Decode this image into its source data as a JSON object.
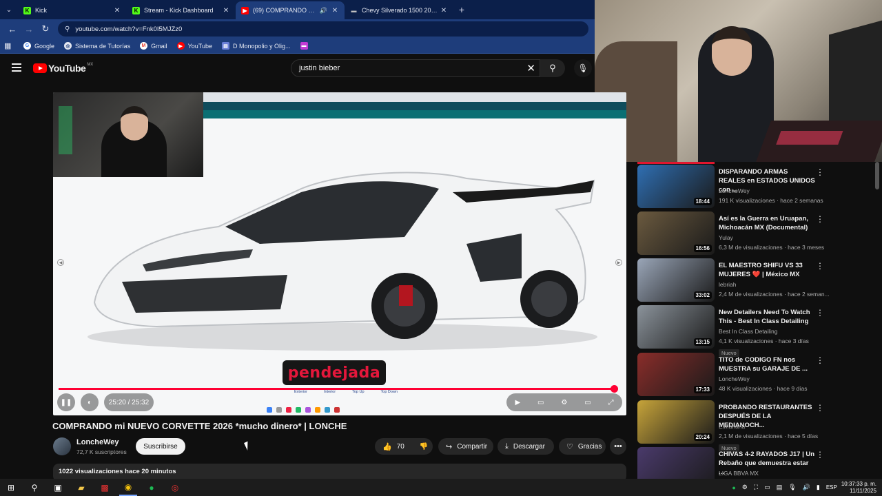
{
  "browser": {
    "tabs": [
      {
        "title": "Kick",
        "icon": "kick-icon",
        "color": "#53fc18",
        "active": false
      },
      {
        "title": "Stream - Kick Dashboard",
        "icon": "kick-icon",
        "color": "#53fc18",
        "active": false
      },
      {
        "title": "(69) COMPRANDO mi NUEVO CORVETTE 2026",
        "icon": "youtube-icon",
        "color": "#ff0000",
        "active": true
      },
      {
        "title": "Chevy Silverado 1500 2026 | Camioneta",
        "icon": "chevrolet-icon",
        "color": "#c0c0c0",
        "active": false
      }
    ],
    "url": "youtube.com/watch?v=Fnk0I5MJZz0",
    "bookmarks": [
      "Google",
      "Sistema de Tutorías",
      "Gmail",
      "YouTube",
      "D Monopolio y Olig..."
    ]
  },
  "youtube": {
    "logo_text": "YouTube",
    "country": "MX",
    "search_query": "justin bieber"
  },
  "player": {
    "overlay_text": "pendejada",
    "car_tabs": [
      "Exterior",
      "Interior",
      "Top Up",
      "Top Down"
    ],
    "time": "25:20 / 25:32",
    "progress_fraction": 0.992
  },
  "video": {
    "title": "COMPRANDO mi NUEVO CORVETTE 2026 *mucho dinero* | LONCHE",
    "channel": "LoncheWey",
    "subscribers": "72,7 K suscriptores",
    "subscribe_label": "Suscribirse",
    "likes": "70",
    "share_label": "Compartir",
    "download_label": "Descargar",
    "thanks_label": "Gracias",
    "views_line": "1022 visualizaciones  hace 20 minutos"
  },
  "recommendations": [
    {
      "title": "DISPARANDO ARMAS REALES en ESTADOS UNIDOS con ...",
      "channel": "LoncheWey",
      "meta": "191 K visualizaciones · hace 2 semanas",
      "duration": "18:44",
      "badge": "",
      "color": "#2f6fb3"
    },
    {
      "title": "Así es la Guerra en Uruapan, Michoacán MX (Documental)",
      "channel": "Yulay",
      "meta": "6,3 M de visualizaciones · hace 3 meses",
      "duration": "16:56",
      "badge": "",
      "color": "#6b5a3f"
    },
    {
      "title": "EL MAESTRO SHIFU VS 33 MUJERES ❤️ | México MX",
      "channel": "lebriah",
      "meta": "2,4 M de visualizaciones · hace 2 seman...",
      "duration": "33:02",
      "badge": "",
      "color": "#9aa6b8"
    },
    {
      "title": "New Detailers Need To Watch This - Best In Class Detailing",
      "channel": "Best In Class Detailing",
      "meta": "4,1 K visualizaciones · hace 3 días",
      "duration": "13:15",
      "badge": "Nuevo",
      "color": "#8b939b"
    },
    {
      "title": "TITO de CODIGO FN nos MUESTRA su GARAJE DE ...",
      "channel": "LoncheWey",
      "meta": "48 K visualizaciones · hace 9 días",
      "duration": "17:33",
      "badge": "",
      "color": "#8a2d2a"
    },
    {
      "title": "PROBANDO RESTAURANTES DESPUÉS DE LA MEDIANOCH...",
      "channel": "ElMariana",
      "meta": "2,1 M de visualizaciones · hace 5 días",
      "duration": "20:24",
      "badge": "Nuevo",
      "color": "#c7a43a"
    },
    {
      "title": "CHIVAS 4-2 RAYADOS J17 | Un Rebaño que demuestra estar ...",
      "channel": "LIGA BBVA MX",
      "meta": "",
      "duration": "",
      "badge": "",
      "color": "#4a3a6b"
    }
  ],
  "taskbar": {
    "language": "ESP",
    "time": "10:37:33 p. m.",
    "date": "11/11/2025"
  }
}
